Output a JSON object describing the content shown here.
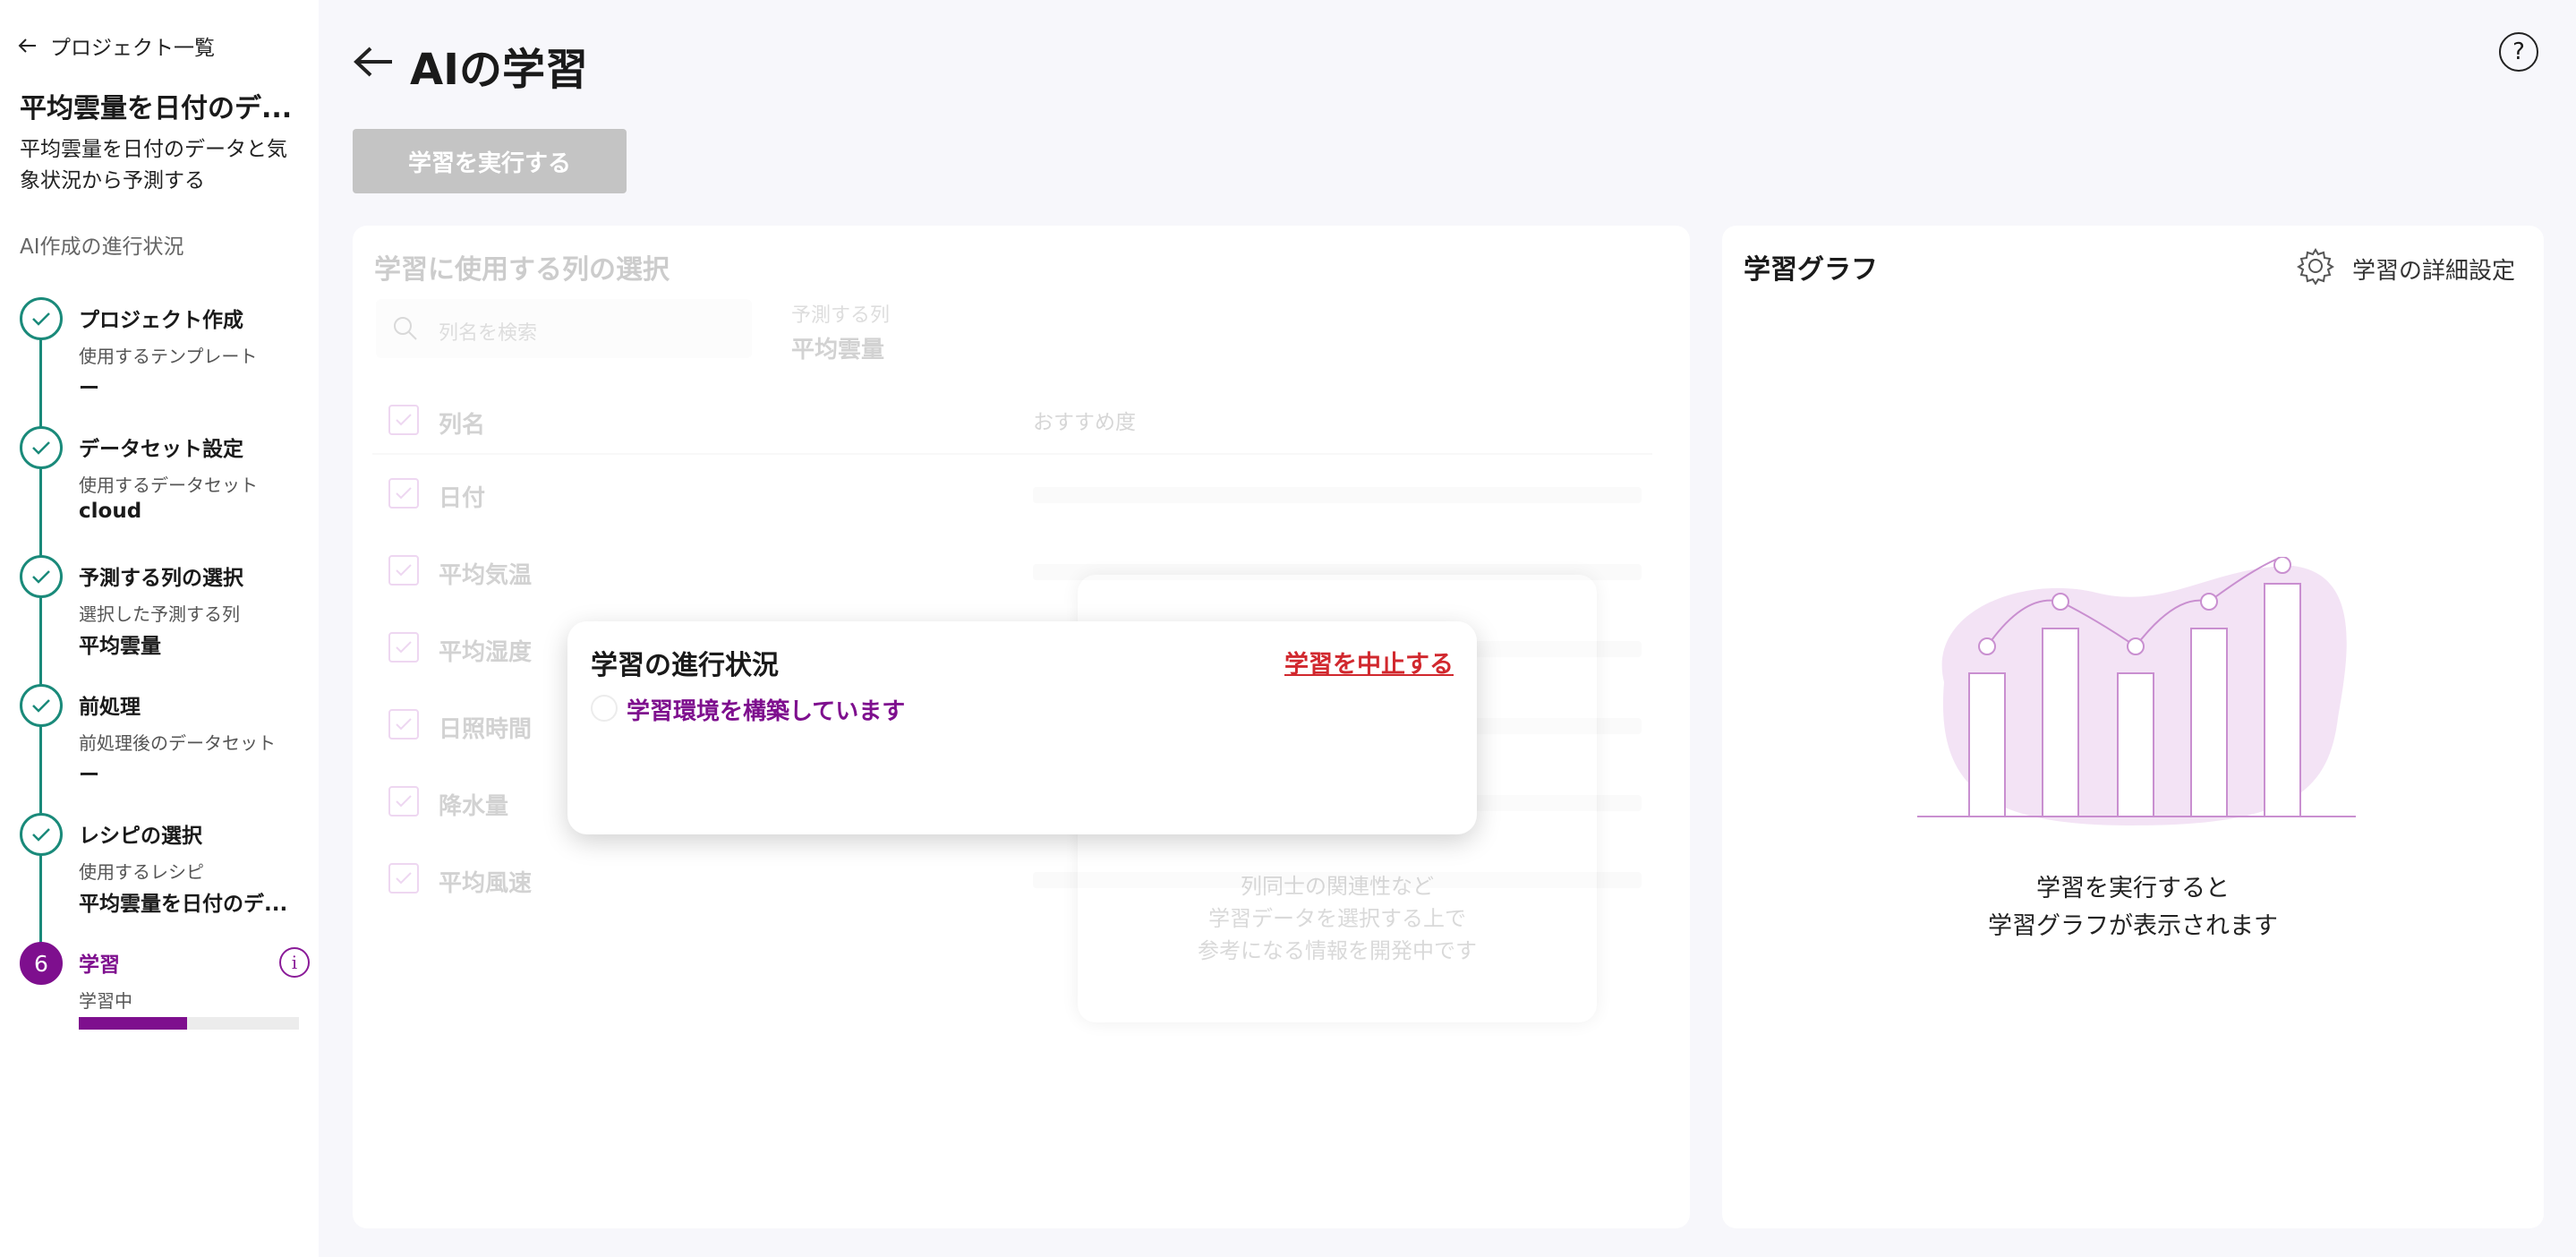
{
  "sidebar": {
    "back_label": "プロジェクト一覧",
    "project_title": "平均雲量を日付のデ...",
    "project_desc": "平均雲量を日付のデータと気象状況から予測する",
    "progress_heading": "AI作成の進行状況",
    "steps": [
      {
        "title": "プロジェクト作成",
        "sub": "使用するテンプレート",
        "value": "ー"
      },
      {
        "title": "データセット設定",
        "sub": "使用するデータセット",
        "value": "cloud"
      },
      {
        "title": "予測する列の選択",
        "sub": "選択した予測する列",
        "value": "平均雲量"
      },
      {
        "title": "前処理",
        "sub": "前処理後のデータセット",
        "value": "ー"
      },
      {
        "title": "レシピの選択",
        "sub": "使用するレシピ",
        "value": "平均雲量を日付のデ..."
      },
      {
        "number": "6",
        "title": "学習",
        "sub": "学習中",
        "progress": 0.49
      }
    ]
  },
  "header": {
    "title": "AIの学習",
    "run_button": "学習を実行する"
  },
  "column_select": {
    "title": "学習に使用する列の選択",
    "search_placeholder": "列名を検索",
    "target_label": "予測する列",
    "target_value": "平均雲量",
    "col_header_name": "列名",
    "col_header_rec": "おすすめ度",
    "rows": [
      "日付",
      "平均気温",
      "平均湿度",
      "日照時間",
      "降水量",
      "平均風速"
    ],
    "info_lines": [
      "列同士の関連性など",
      "学習データを選択する上で",
      "参考になる情報を開発中です"
    ]
  },
  "modal": {
    "title": "学習の進行状況",
    "stop_label": "学習を中止する",
    "status": "学習環境を構築しています"
  },
  "graph": {
    "title": "学習グラフ",
    "settings_label": "学習の詳細設定",
    "empty_line1": "学習を実行すると",
    "empty_line2": "学習グラフが表示されます"
  },
  "colors": {
    "accent": "#7e0f8e",
    "teal": "#1a8a7a",
    "stop": "#d1282e"
  }
}
